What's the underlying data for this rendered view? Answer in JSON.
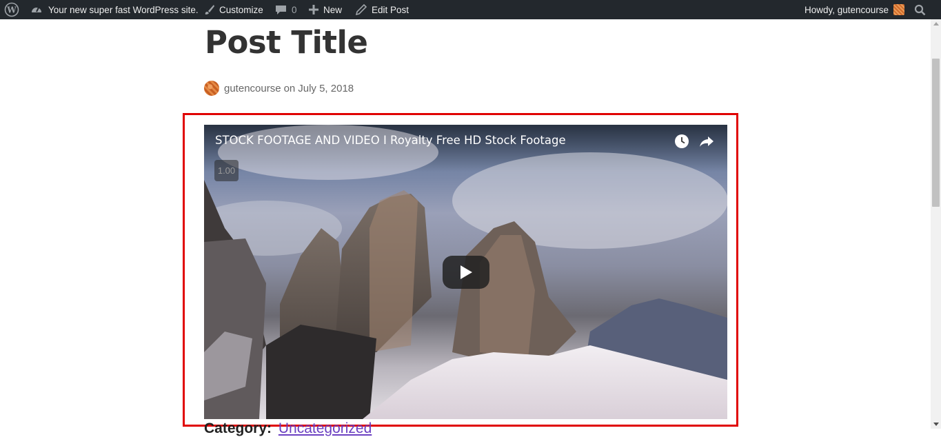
{
  "adminbar": {
    "site_name": "Your new super fast WordPress site.",
    "customize": "Customize",
    "comments_count": "0",
    "new": "New",
    "edit_post": "Edit Post",
    "howdy": "Howdy, gutencourse"
  },
  "post": {
    "title": "Post Title",
    "author": "gutencourse",
    "on": "on",
    "date": "July 5, 2018"
  },
  "video": {
    "title": "STOCK FOOTAGE AND VIDEO I Royalty Free HD Stock Footage",
    "speed": "1.00"
  },
  "footer": {
    "category_label": "Category:",
    "category_value": "Uncategorized"
  },
  "colors": {
    "adminbar_bg": "#23282d",
    "highlight": "#e00000",
    "link": "#6a3fc1"
  },
  "icons": [
    "wordpress-logo-icon",
    "dashboard-icon",
    "brush-icon",
    "comment-icon",
    "plus-icon",
    "pencil-icon",
    "search-icon",
    "clock-icon",
    "share-icon",
    "play-icon"
  ]
}
